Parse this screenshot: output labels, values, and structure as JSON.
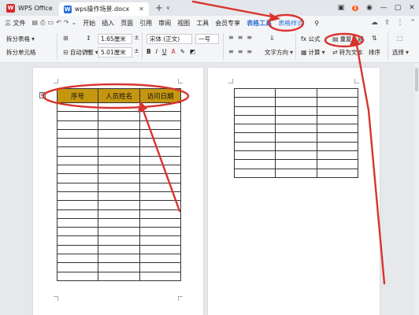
{
  "app": {
    "name": "WPS Office"
  },
  "doc_tab": {
    "title": "wps操作场景.docx"
  },
  "window": {
    "badge": "1"
  },
  "menu": {
    "file": "三 文件",
    "items": [
      "开始",
      "插入",
      "页面",
      "引用",
      "审阅",
      "视图",
      "工具",
      "会员专享"
    ],
    "table_tools": "表格工具",
    "table_style": "表格样式"
  },
  "toolbar": {
    "split_table": "拆分表格",
    "split_cell": "拆分单元格",
    "auto_fit": "自动调整",
    "row_height": "1.65厘米",
    "col_width": "5.01厘米",
    "font_name": "宋体 (正文)",
    "font_size": "一号",
    "text_direction": "文字方向",
    "formula": "fx 公式",
    "calculate": "计算",
    "repeat_header": "重复标题",
    "convert_text": "转为文本",
    "sort": "排序",
    "select": "选择"
  },
  "table": {
    "headers": [
      "序号",
      "人员姓名",
      "访问日期"
    ]
  },
  "colors": {
    "header_fill": "#c5960f",
    "annotation": "#d9332e",
    "accent": "#2f6fd6"
  }
}
